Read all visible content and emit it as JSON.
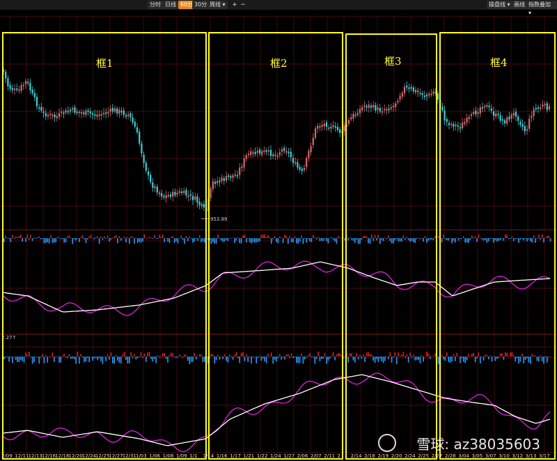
{
  "toolbar": {
    "periods": [
      "分时",
      "日线",
      "60分",
      "30分",
      "周线 ▾"
    ],
    "active_period": "60分",
    "zoom_in": "+",
    "zoom_out": "−",
    "right_buttons": [
      "操盘线 ▾",
      "画线",
      "指数叠加 ▾"
    ]
  },
  "frames": [
    {
      "label": "框1"
    },
    {
      "label": "框2"
    },
    {
      "label": "框3"
    },
    {
      "label": "框4"
    }
  ],
  "price_low_label": "953.89",
  "indicator_side_label": "2.27↑",
  "dates": [
    "2/09",
    "12/11",
    "12/13",
    "12/16",
    "12/18",
    "12/20",
    "12/24",
    "12/25",
    "12/27",
    "12/31",
    "1/03",
    "1/06",
    "1/08",
    "1/09",
    "1/1",
    "1/14",
    "1/16",
    "1/17",
    "1/21",
    "1/22",
    "1/24",
    "1/27",
    "2/06",
    "2/07",
    "2/11",
    "2",
    "2/14",
    "2/18",
    "2/19",
    "2/20",
    "2/24",
    "2/25",
    "2/27",
    "2/28",
    "3/04",
    "3/05",
    "3/07",
    "3/10",
    "3/12",
    "3/13",
    "3/17"
  ],
  "watermark": "雪球: az38035603",
  "colors": {
    "up": "#d96a6a",
    "down": "#3fcfd6",
    "frame": "#ffff22",
    "bar_up": "#e02020",
    "bar_down": "#1f9cff",
    "fast_line": "#e020e0",
    "slow_line": "#ffffff"
  }
}
